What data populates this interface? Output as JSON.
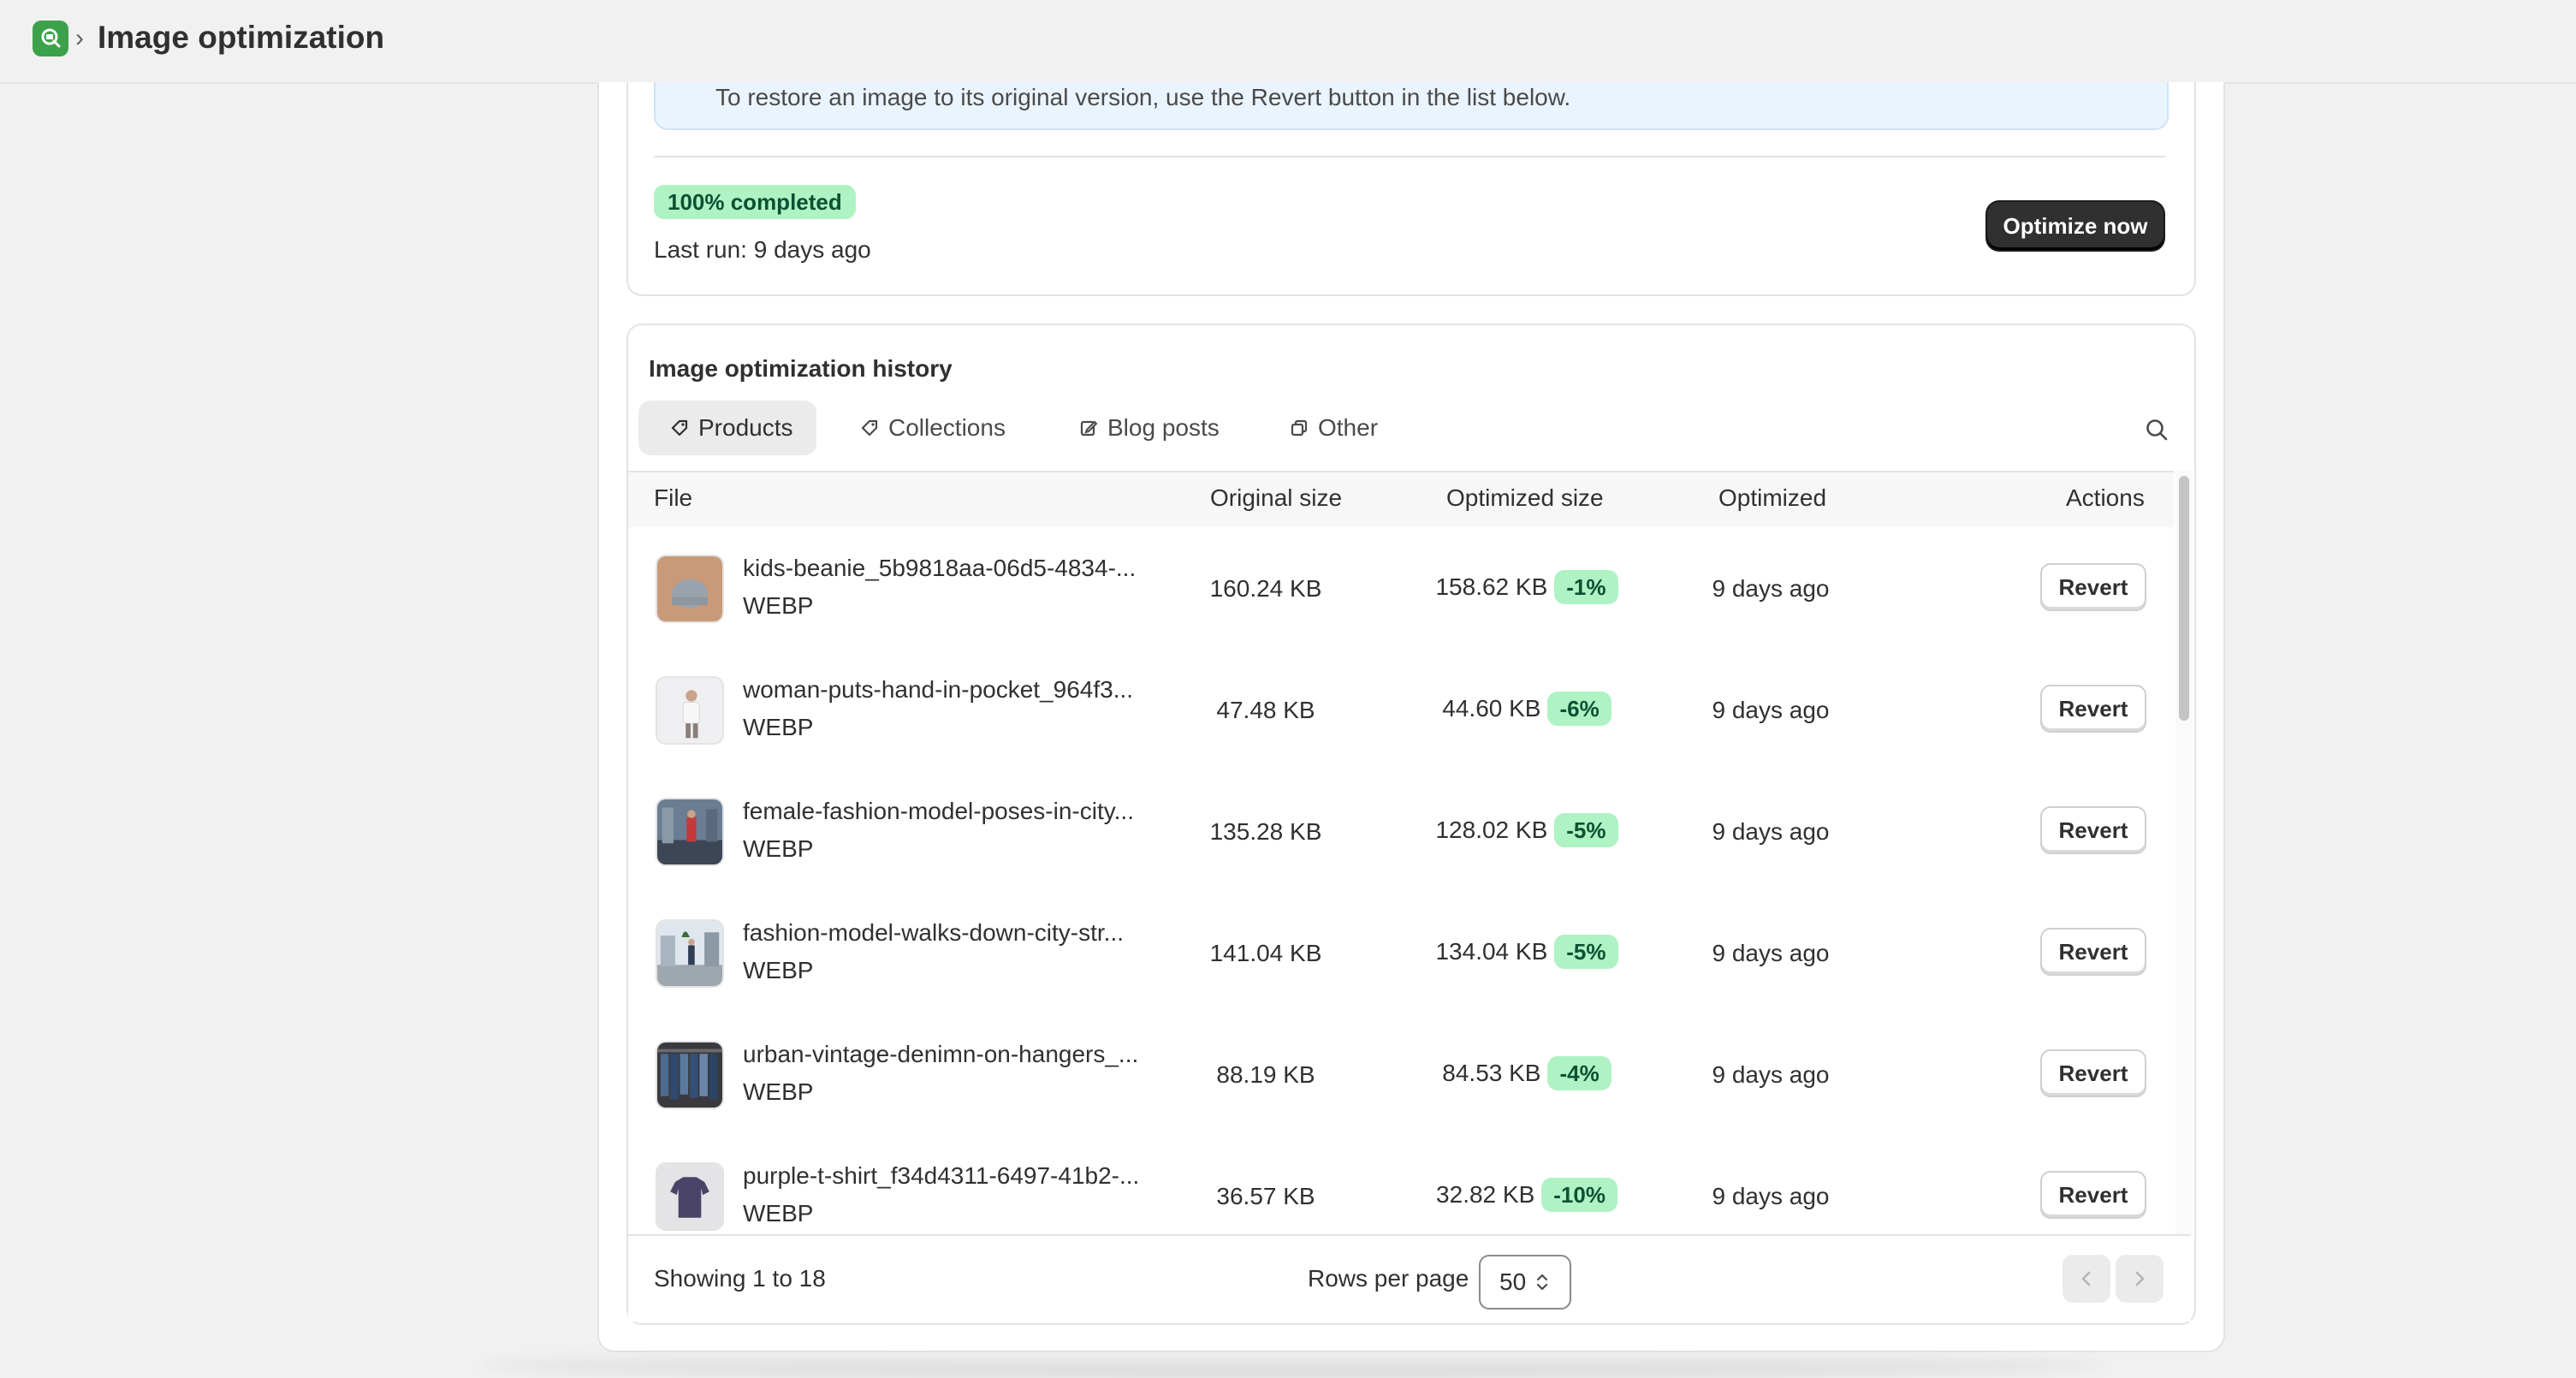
{
  "header": {
    "app_icon": "search-magnifier-icon",
    "breadcrumb_separator": "›",
    "title": "Image optimization"
  },
  "progress": {
    "banner_text": "To restore an image to its original version, use the Revert button in the list below.",
    "status_badge": "100% completed",
    "last_run": "Last run: 9 days ago",
    "optimize_label": "Optimize now"
  },
  "history": {
    "title": "Image optimization history",
    "tabs": [
      {
        "label": "Products",
        "icon": "tag-icon",
        "active": true
      },
      {
        "label": "Collections",
        "icon": "tag-icon",
        "active": false
      },
      {
        "label": "Blog posts",
        "icon": "edit-icon",
        "active": false
      },
      {
        "label": "Other",
        "icon": "copy-icon",
        "active": false
      }
    ],
    "columns": {
      "file": "File",
      "original": "Original size",
      "optimized": "Optimized size",
      "when": "Optimized",
      "actions": "Actions"
    },
    "rows": [
      {
        "name": "kids-beanie_5b9818aa-06d5-4834-...",
        "type": "WEBP",
        "original": "160.24 KB",
        "optimized": "158.62 KB",
        "pct": "-1%",
        "when": "9 days ago",
        "action": "Revert"
      },
      {
        "name": "woman-puts-hand-in-pocket_964f3...",
        "type": "WEBP",
        "original": "47.48 KB",
        "optimized": "44.60 KB",
        "pct": "-6%",
        "when": "9 days ago",
        "action": "Revert"
      },
      {
        "name": "female-fashion-model-poses-in-city...",
        "type": "WEBP",
        "original": "135.28 KB",
        "optimized": "128.02 KB",
        "pct": "-5%",
        "when": "9 days ago",
        "action": "Revert"
      },
      {
        "name": "fashion-model-walks-down-city-str...",
        "type": "WEBP",
        "original": "141.04 KB",
        "optimized": "134.04 KB",
        "pct": "-5%",
        "when": "9 days ago",
        "action": "Revert"
      },
      {
        "name": "urban-vintage-denimn-on-hangers_...",
        "type": "WEBP",
        "original": "88.19 KB",
        "optimized": "84.53 KB",
        "pct": "-4%",
        "when": "9 days ago",
        "action": "Revert"
      },
      {
        "name": "purple-t-shirt_f34d4311-6497-41b2-...",
        "type": "WEBP",
        "original": "36.57 KB",
        "optimized": "32.82 KB",
        "pct": "-10%",
        "when": "9 days ago",
        "action": "Revert"
      }
    ],
    "footer": {
      "showing": "Showing 1 to 18",
      "rows_label": "Rows per page",
      "rows_value": "50"
    }
  },
  "colors": {
    "accent_dark": "#303030",
    "success_bg": "#aff2c4",
    "success_text": "#0c5132",
    "app_green": "#3ca24a"
  }
}
